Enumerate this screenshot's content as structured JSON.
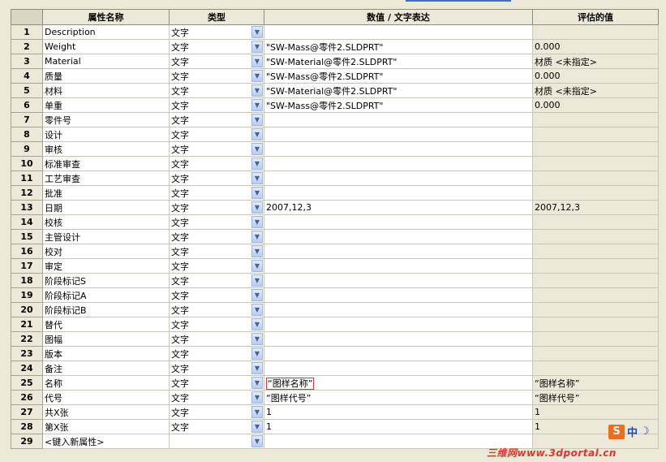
{
  "headers": {
    "property": "属性名称",
    "type": "类型",
    "value": "数值 / 文字表达",
    "evaluated": "评估的值"
  },
  "rows": [
    {
      "n": "1",
      "prop": "Description",
      "type": "文字",
      "value": "",
      "evaluated": ""
    },
    {
      "n": "2",
      "prop": "Weight",
      "type": "文字",
      "value": "\"SW-Mass@零件2.SLDPRT\"",
      "evaluated": "0.000"
    },
    {
      "n": "3",
      "prop": "Material",
      "type": "文字",
      "value": "\"SW-Material@零件2.SLDPRT\"",
      "evaluated": "材质 <未指定>"
    },
    {
      "n": "4",
      "prop": "质量",
      "type": "文字",
      "value": "\"SW-Mass@零件2.SLDPRT\"",
      "evaluated": "0.000"
    },
    {
      "n": "5",
      "prop": "材料",
      "type": "文字",
      "value": "\"SW-Material@零件2.SLDPRT\"",
      "evaluated": "材质 <未指定>"
    },
    {
      "n": "6",
      "prop": "单重",
      "type": "文字",
      "value": "\"SW-Mass@零件2.SLDPRT\"",
      "evaluated": "0.000"
    },
    {
      "n": "7",
      "prop": "零件号",
      "type": "文字",
      "value": "",
      "evaluated": ""
    },
    {
      "n": "8",
      "prop": "设计",
      "type": "文字",
      "value": "",
      "evaluated": ""
    },
    {
      "n": "9",
      "prop": "审核",
      "type": "文字",
      "value": "",
      "evaluated": ""
    },
    {
      "n": "10",
      "prop": "标准审查",
      "type": "文字",
      "value": "",
      "evaluated": ""
    },
    {
      "n": "11",
      "prop": "工艺审查",
      "type": "文字",
      "value": "",
      "evaluated": ""
    },
    {
      "n": "12",
      "prop": "批准",
      "type": "文字",
      "value": "",
      "evaluated": ""
    },
    {
      "n": "13",
      "prop": "日期",
      "type": "文字",
      "value": "2007,12,3",
      "evaluated": "2007,12,3"
    },
    {
      "n": "14",
      "prop": "校核",
      "type": "文字",
      "value": "",
      "evaluated": ""
    },
    {
      "n": "15",
      "prop": "主管设计",
      "type": "文字",
      "value": "",
      "evaluated": ""
    },
    {
      "n": "16",
      "prop": "校对",
      "type": "文字",
      "value": "",
      "evaluated": ""
    },
    {
      "n": "17",
      "prop": "审定",
      "type": "文字",
      "value": "",
      "evaluated": ""
    },
    {
      "n": "18",
      "prop": "阶段标记S",
      "type": "文字",
      "value": "",
      "evaluated": ""
    },
    {
      "n": "19",
      "prop": "阶段标记A",
      "type": "文字",
      "value": "",
      "evaluated": ""
    },
    {
      "n": "20",
      "prop": "阶段标记B",
      "type": "文字",
      "value": "",
      "evaluated": ""
    },
    {
      "n": "21",
      "prop": "替代",
      "type": "文字",
      "value": "",
      "evaluated": ""
    },
    {
      "n": "22",
      "prop": "图幅",
      "type": "文字",
      "value": "",
      "evaluated": ""
    },
    {
      "n": "23",
      "prop": "版本",
      "type": "文字",
      "value": "",
      "evaluated": ""
    },
    {
      "n": "24",
      "prop": "备注",
      "type": "文字",
      "value": "",
      "evaluated": ""
    },
    {
      "n": "25",
      "prop": "名称",
      "type": "文字",
      "value": "“图样名称”",
      "evaluated": "“图样名称”",
      "selected": true
    },
    {
      "n": "26",
      "prop": "代号",
      "type": "文字",
      "value": "“图样代号”",
      "evaluated": "“图样代号”"
    },
    {
      "n": "27",
      "prop": "共X张",
      "type": "文字",
      "value": "1",
      "evaluated": "1"
    },
    {
      "n": "28",
      "prop": "第X张",
      "type": "文字",
      "value": "1",
      "evaluated": "1"
    },
    {
      "n": "29",
      "prop": "<键入新属性>",
      "type": "",
      "value": "",
      "evaluated": ""
    }
  ],
  "icons": {
    "dropdown": "chevron-down-icon"
  },
  "ime": {
    "logo": "S",
    "lang": "中",
    "mode": "☽"
  },
  "watermark": "三维网www.3dportal.cn"
}
